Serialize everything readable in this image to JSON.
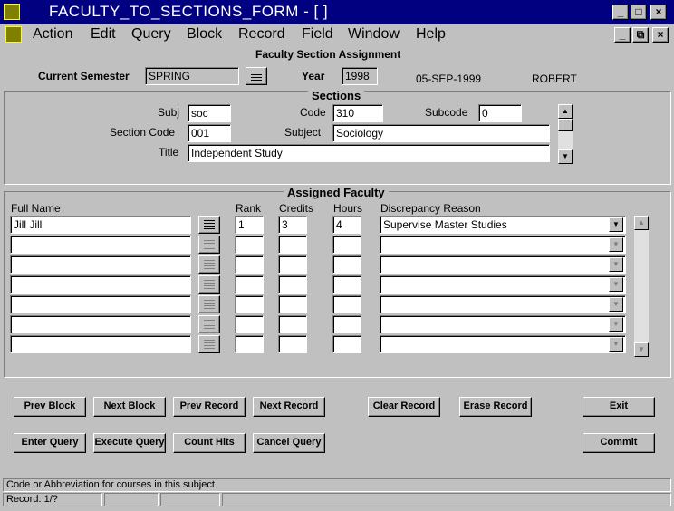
{
  "window": {
    "title": "FACULTY_TO_SECTIONS_FORM - [ ]"
  },
  "menu": {
    "items": [
      "Action",
      "Edit",
      "Query",
      "Block",
      "Record",
      "Field",
      "Window",
      "Help"
    ]
  },
  "form": {
    "title": "Faculty Section Assignment",
    "current_semester_label": "Current Semester",
    "current_semester_value": "SPRING",
    "year_label": "Year",
    "year_value": "1998",
    "date": "05-SEP-1999",
    "user": "ROBERT"
  },
  "sections": {
    "legend": "Sections",
    "subj_label": "Subj",
    "subj_value": "soc",
    "code_label": "Code",
    "code_value": "310",
    "subcode_label": "Subcode",
    "subcode_value": "0",
    "section_code_label": "Section Code",
    "section_code_value": "001",
    "subject_label": "Subject",
    "subject_value": "Sociology",
    "title_label": "Title",
    "title_value": "Independent Study"
  },
  "faculty": {
    "legend": "Assigned Faculty",
    "columns": {
      "full_name": "Full Name",
      "rank": "Rank",
      "credits": "Credits",
      "hours": "Hours",
      "discrepancy": "Discrepancy Reason"
    },
    "rows": [
      {
        "full_name": "Jill  Jill",
        "rank": "1",
        "credits": "3",
        "hours": "4",
        "discrepancy": "Supervise Master Studies"
      },
      {
        "full_name": "",
        "rank": "",
        "credits": "",
        "hours": "",
        "discrepancy": ""
      },
      {
        "full_name": "",
        "rank": "",
        "credits": "",
        "hours": "",
        "discrepancy": ""
      },
      {
        "full_name": "",
        "rank": "",
        "credits": "",
        "hours": "",
        "discrepancy": ""
      },
      {
        "full_name": "",
        "rank": "",
        "credits": "",
        "hours": "",
        "discrepancy": ""
      },
      {
        "full_name": "",
        "rank": "",
        "credits": "",
        "hours": "",
        "discrepancy": ""
      },
      {
        "full_name": "",
        "rank": "",
        "credits": "",
        "hours": "",
        "discrepancy": ""
      }
    ]
  },
  "buttons": {
    "prev_block": "Prev Block",
    "next_block": "Next Block",
    "prev_record": "Prev Record",
    "next_record": "Next Record",
    "clear_record": "Clear Record",
    "erase_record": "Erase Record",
    "exit": "Exit",
    "enter_query": "Enter Query",
    "execute_query": "Execute Query",
    "count_hits": "Count Hits",
    "cancel_query": "Cancel Query",
    "commit": "Commit"
  },
  "status": {
    "hint": "Code or Abbreviation for courses in this subject",
    "record": "Record: 1/?"
  },
  "icons": {
    "app": "oracle-forms-app-icon",
    "lov": "list-of-values-icon",
    "dropdown": "chevron-down-icon"
  }
}
